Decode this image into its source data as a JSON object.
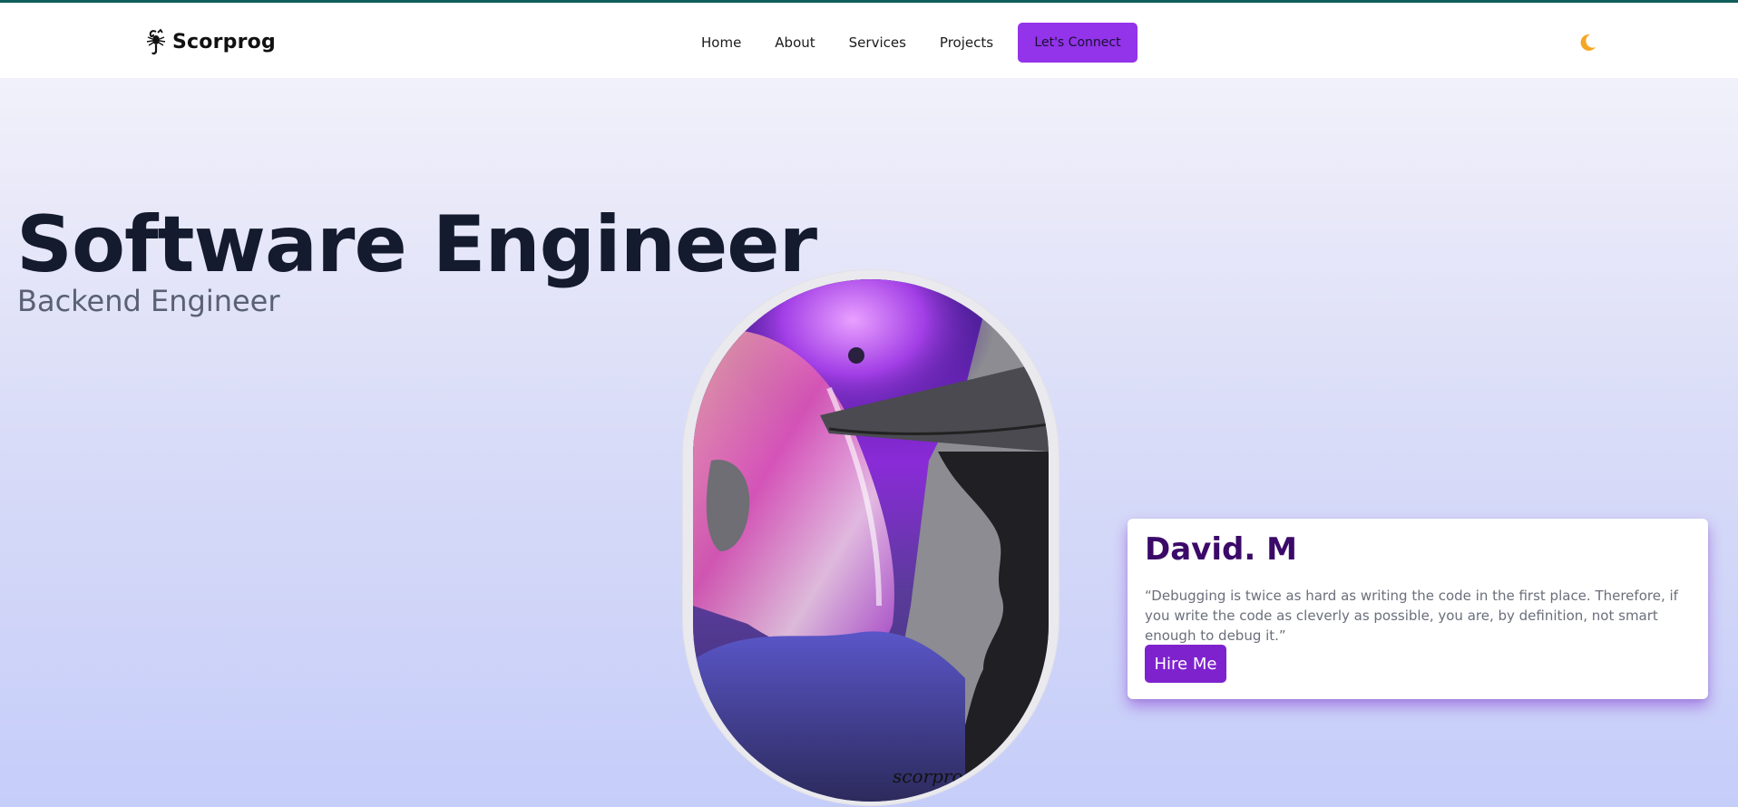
{
  "brand": {
    "name": "Scorprog",
    "logo_icon": "scorpion-icon"
  },
  "nav": {
    "items": [
      {
        "label": "Home"
      },
      {
        "label": "About"
      },
      {
        "label": "Services"
      },
      {
        "label": "Projects"
      }
    ],
    "cta_label": "Let's Connect"
  },
  "theme_toggle": {
    "icon": "moon-icon",
    "color": "#f5a623"
  },
  "hero": {
    "title": "Software Engineer",
    "subtitle": "Backend Engineer"
  },
  "portrait": {
    "signature": "scorprog"
  },
  "card": {
    "name": "David. M",
    "quote": "“Debugging is twice as hard as writing the code in the first place. Therefore, if you write the code as cleverly as possible, you are, by definition, not smart enough to debug it.”",
    "button_label": "Hire Me"
  },
  "colors": {
    "accent": "#9333ea",
    "accent_dark": "#7e22ce",
    "title": "#151b2e",
    "name": "#3b0a69",
    "top_line": "#0f5d5a"
  }
}
